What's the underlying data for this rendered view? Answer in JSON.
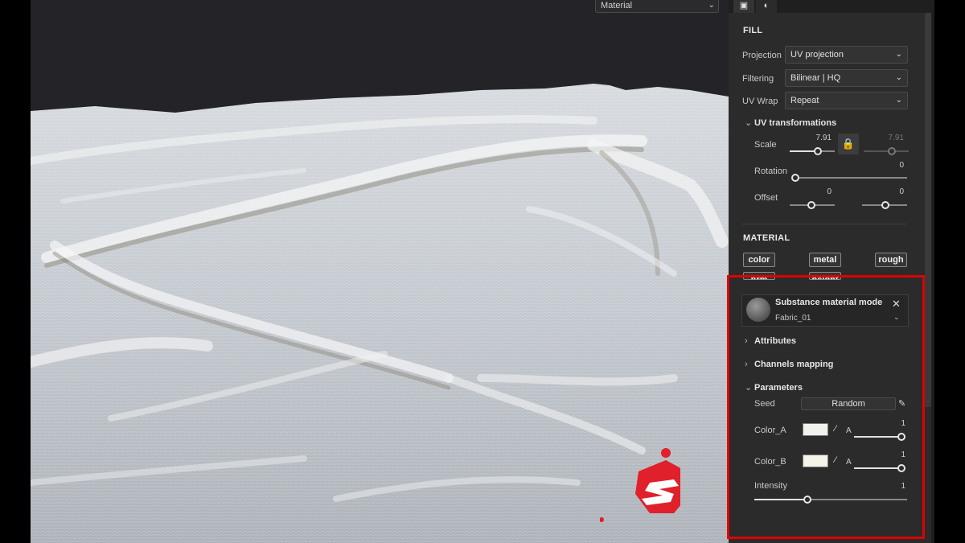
{
  "viewport": {
    "view_mode": "Material"
  },
  "panel": {
    "tabs": [
      "camera-icon",
      "contrast-icon"
    ],
    "fill": {
      "title": "FILL",
      "projection_label": "Projection",
      "projection_value": "UV projection",
      "filtering_label": "Filtering",
      "filtering_value": "Bilinear | HQ",
      "uvwrap_label": "UV Wrap",
      "uvwrap_value": "Repeat"
    },
    "uv_transformations": {
      "title": "UV transformations",
      "scale_label": "Scale",
      "scale_u": "7.91",
      "scale_v": "7.91",
      "rotation_label": "Rotation",
      "rotation_value": "0",
      "offset_label": "Offset",
      "offset_u": "0",
      "offset_v": "0"
    },
    "material": {
      "title": "MATERIAL",
      "channels": [
        "color",
        "metal",
        "rough",
        "nrm",
        "height"
      ]
    },
    "substance": {
      "title": "Substance material mode",
      "name": "Fabric_01"
    },
    "sections": {
      "attributes": "Attributes",
      "channels_mapping": "Channels mapping",
      "parameters": "Parameters"
    },
    "parameters": {
      "seed_label": "Seed",
      "seed_value": "Random",
      "color_a_label": "Color_A",
      "color_a_alpha_label": "A",
      "color_a_alpha_value": "1",
      "color_a_swatch": "#f2f1ee",
      "color_b_label": "Color_B",
      "color_b_alpha_label": "A",
      "color_b_alpha_value": "1",
      "color_b_swatch": "#f6f3e8",
      "intensity_label": "Intensity",
      "intensity_value": "1"
    }
  },
  "colors": {
    "panel_bg": "#2b2b2b",
    "highlight": "#e00000",
    "logo": "#e0202a"
  }
}
